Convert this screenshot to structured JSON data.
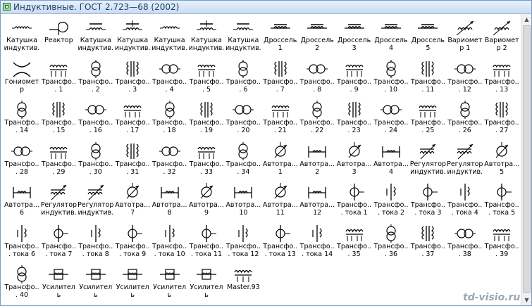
{
  "window": {
    "title": "Индуктивные. ГОСТ 2.723—68 (2002)"
  },
  "watermark": "td-visio.ru",
  "rows": [
    [
      "Катушка индуктив...",
      "Реактор",
      "Катушка индуктив...",
      "Катушка индуктив...",
      "Катушка индуктив...",
      "Катушка индуктив...",
      "Катушка индуктив...",
      "Дроссель 1",
      "Дроссель 2",
      "Дроссель 3",
      "Дроссель 4",
      "Дроссель 5",
      "Вариометр 1",
      "Вариометр 2"
    ],
    [
      "Гониометр",
      "Трансфо... 1",
      "Трансфо... 2",
      "Трансфо... 3",
      "Трансфо... 4",
      "Трансфо... 5",
      "Трансфо... 6",
      "Трансфо... 7",
      "Трансфо... 8",
      "Трансфо... 9",
      "Трансфо... 10",
      "Трансфо... 11",
      "Трансфо... 12",
      "Трансфо... 13"
    ],
    [
      "Трансфо... 14",
      "Трансфо... 15",
      "Трансфо... 16",
      "Трансфо... 17",
      "Трансфо... 18",
      "Трансфо... 19",
      "Трансфо... 20",
      "Трансфо... 21",
      "Трансфо... 22",
      "Трансфо... 23",
      "Трансфо... 24",
      "Трансфо... 25",
      "Трансфо... 26",
      "Трансфо... 27"
    ],
    [
      "Трансфо... 28",
      "Трансфо... 29",
      "Трансфо... 30",
      "Трансфо... 31",
      "Трансфо... 32",
      "Трансфо... 33",
      "Трансфо... 34",
      "Автотра... 1",
      "Автотра... 2",
      "Автотра... 3",
      "Автотра... 4",
      "Регулятор индуктив...",
      "Регулятор индуктив...",
      "Автотра... 5"
    ],
    [
      "Автотра... 6",
      "Регулятор индуктив...",
      "Регулятор индуктив...",
      "Автотра... 7",
      "Автотра... 8",
      "Автотра... 9",
      "Автотра... 10",
      "Автотра... 11",
      "Автотра... 12",
      "Трансфо... тока 1",
      "Трансфо... тока 2",
      "Трансфо... тока 3",
      "Трансфо... тока 4",
      "Трансфо... тока 5"
    ],
    [
      "Трансфо... тока 6",
      "Трансфо... тока 7",
      "Трансфо... тока 8",
      "Трансфо... тока 9",
      "Трансфо... тока 10",
      "Трансфо... тока 11",
      "Трансфо... тока 12",
      "Трансфо... тока 13",
      "Трансфо... тока 14",
      "Трансфо... 35",
      "Трансфо... 36",
      "Трансфо... 37",
      "Трансфо... 38",
      "Трансфо... 39"
    ],
    [
      "Трансфо... 40",
      "Усилитель магнитн...",
      "Усилитель магнитн...",
      "Усилитель магнитн...",
      "Усилитель магнитн...",
      "Усилитель магнитн...",
      "Master.93"
    ]
  ],
  "icons": [
    [
      "coil-icon",
      "reactor-icon",
      "coil-core-icon",
      "coil-core-icon",
      "coil-icon",
      "coil-core-icon",
      "coil-core-icon",
      "choke-icon",
      "choke-icon",
      "choke-icon",
      "choke-icon",
      "choke-icon",
      "variometer-icon",
      "variometer-icon"
    ],
    [
      "goniometer-icon",
      "transformer-icon",
      "transformer-icon",
      "transformer-icon",
      "transformer-icon",
      "transformer-icon",
      "transformer-icon",
      "transformer-icon",
      "transformer-icon",
      "transformer-icon",
      "transformer-icon",
      "transformer-icon",
      "transformer-icon",
      "transformer-icon"
    ],
    [
      "transformer-icon",
      "transformer-icon",
      "transformer-icon",
      "transformer-icon",
      "transformer-icon",
      "transformer-icon",
      "transformer-icon",
      "transformer-icon",
      "transformer-icon",
      "transformer-icon",
      "transformer-icon",
      "transformer-icon",
      "transformer-icon",
      "transformer-icon"
    ],
    [
      "transformer-icon",
      "transformer-icon",
      "transformer-icon",
      "transformer-icon",
      "transformer-icon",
      "transformer-icon",
      "transformer-icon",
      "autotransformer-icon",
      "autotransformer-icon",
      "autotransformer-icon",
      "autotransformer-icon",
      "regulator-icon",
      "regulator-icon",
      "autotransformer-icon"
    ],
    [
      "autotransformer-icon",
      "regulator-icon",
      "regulator-icon",
      "autotransformer-icon",
      "autotransformer-icon",
      "autotransformer-icon",
      "autotransformer-icon",
      "autotransformer-icon",
      "autotransformer-icon",
      "current-transformer-icon",
      "current-transformer-icon",
      "current-transformer-icon",
      "current-transformer-icon",
      "current-transformer-icon"
    ],
    [
      "current-transformer-icon",
      "current-transformer-icon",
      "current-transformer-icon",
      "current-transformer-icon",
      "current-transformer-icon",
      "current-transformer-icon",
      "current-transformer-icon",
      "current-transformer-icon",
      "current-transformer-icon",
      "transformer-icon",
      "transformer-icon",
      "transformer-icon",
      "transformer-icon",
      "transformer-icon"
    ],
    [
      "transformer-icon",
      "magnetic-amplifier-icon",
      "magnetic-amplifier-icon",
      "magnetic-amplifier-icon",
      "magnetic-amplifier-icon",
      "magnetic-amplifier-icon",
      "master-icon"
    ]
  ]
}
